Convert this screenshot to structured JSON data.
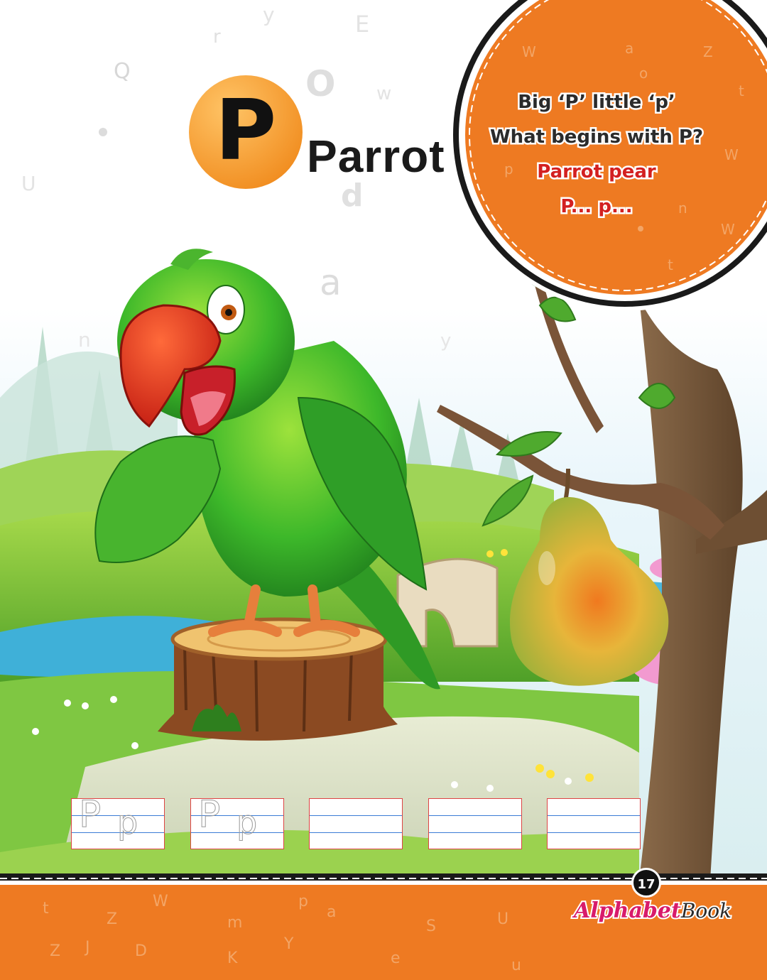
{
  "letter": "P",
  "word": "Parrot",
  "rhyme": {
    "line1": "Big ‘P’ little ‘p’",
    "line2": "What begins with P?",
    "line3": "Parrot   pear",
    "line4": "P...  p..."
  },
  "tracing": {
    "big_letter": "P",
    "small_letter": "p",
    "box_count": 5
  },
  "footer": {
    "page_number": "17",
    "brand_alphabet": "Alphabet",
    "brand_book": "Book"
  },
  "colors": {
    "accent_orange": "#ee7a22",
    "badge_orange": "#f39a2a",
    "rhyme_red": "#d32020",
    "brand_pink": "#d81b6b"
  }
}
